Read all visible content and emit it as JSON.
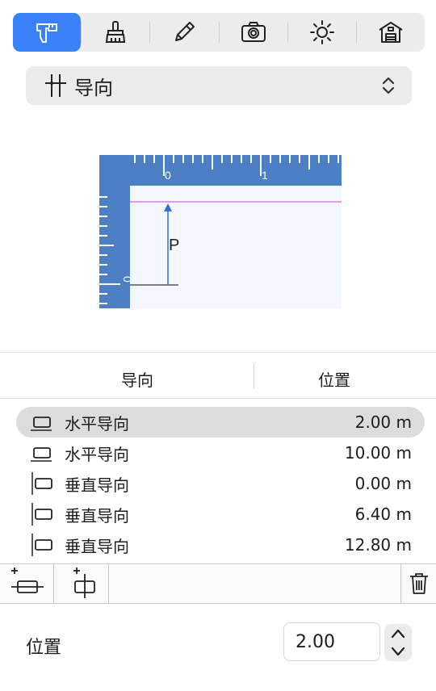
{
  "toolbar": {
    "tabs": [
      {
        "icon": "caliper-icon",
        "active": true
      },
      {
        "icon": "brush-icon",
        "active": false
      },
      {
        "icon": "pencil-icon",
        "active": false
      },
      {
        "icon": "camera-icon",
        "active": false
      },
      {
        "icon": "sun-icon",
        "active": false
      },
      {
        "icon": "house-icon",
        "active": false
      }
    ]
  },
  "guide_select": {
    "label": "导向",
    "icon": "guide-icon"
  },
  "preview": {
    "ruler_top_ticks": [
      "0",
      "1"
    ],
    "ruler_left_tick": "0",
    "point_label": "P"
  },
  "columns": {
    "guide": "导向",
    "position": "位置"
  },
  "guides": [
    {
      "type": "水平导向",
      "value": "2.00 m",
      "orientation": "horizontal",
      "selected": true
    },
    {
      "type": "水平导向",
      "value": "10.00 m",
      "orientation": "horizontal",
      "selected": false
    },
    {
      "type": "垂直导向",
      "value": "0.00 m",
      "orientation": "vertical",
      "selected": false
    },
    {
      "type": "垂直导向",
      "value": "6.40 m",
      "orientation": "vertical",
      "selected": false
    },
    {
      "type": "垂直导向",
      "value": "12.80 m",
      "orientation": "vertical",
      "selected": false
    }
  ],
  "actions": {
    "add_horizontal": "add-horizontal-guide-icon",
    "add_vertical": "add-vertical-guide-icon",
    "delete": "trash-icon"
  },
  "position_field": {
    "label": "位置",
    "value": "2.00"
  },
  "colors": {
    "accent": "#3a82f7",
    "ruler": "#4d7fc4",
    "guide_line": "#e07ee6"
  }
}
